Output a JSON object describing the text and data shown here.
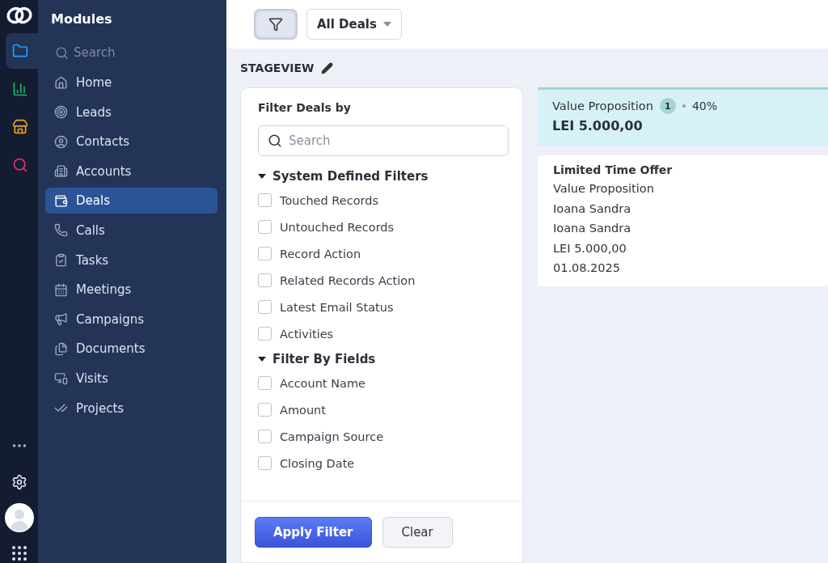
{
  "rail": {
    "items": [
      {
        "selected": true
      },
      {
        "selected": false
      },
      {
        "selected": false
      },
      {
        "selected": false
      }
    ]
  },
  "sidebar": {
    "title": "Modules",
    "search": {
      "placeholder": "Search"
    },
    "items": [
      {
        "label": "Home",
        "selected": false
      },
      {
        "label": "Leads",
        "selected": false
      },
      {
        "label": "Contacts",
        "selected": false
      },
      {
        "label": "Accounts",
        "selected": false
      },
      {
        "label": "Deals",
        "selected": true
      },
      {
        "label": "Calls",
        "selected": false
      },
      {
        "label": "Tasks",
        "selected": false
      },
      {
        "label": "Meetings",
        "selected": false
      },
      {
        "label": "Campaigns",
        "selected": false
      },
      {
        "label": "Documents",
        "selected": false
      },
      {
        "label": "Visits",
        "selected": false
      },
      {
        "label": "Projects",
        "selected": false
      }
    ]
  },
  "toolbar": {
    "filter_active": true,
    "view": "All Deals"
  },
  "view_title": "STAGEVIEW",
  "filter_panel": {
    "title": "Filter Deals by",
    "search": {
      "placeholder": "Search"
    },
    "groups": [
      {
        "label": "System Defined Filters",
        "expanded": true,
        "items": [
          {
            "label": "Touched Records",
            "checked": false
          },
          {
            "label": "Untouched Records",
            "checked": false
          },
          {
            "label": "Record Action",
            "checked": false
          },
          {
            "label": "Related Records Action",
            "checked": false
          },
          {
            "label": "Latest Email Status",
            "checked": false
          },
          {
            "label": "Activities",
            "checked": false
          }
        ]
      },
      {
        "label": "Filter By Fields",
        "expanded": true,
        "items": [
          {
            "label": "Account Name",
            "checked": false
          },
          {
            "label": "Amount",
            "checked": false
          },
          {
            "label": "Campaign Source",
            "checked": false
          },
          {
            "label": "Closing Date",
            "checked": false
          }
        ]
      }
    ],
    "buttons": [
      {
        "label": "Apply Filter",
        "kind": "primary"
      },
      {
        "label": "Clear",
        "kind": "secondary"
      }
    ]
  },
  "stage": {
    "name": "Value Proposition",
    "count": "1",
    "probability": "40%",
    "total": "LEI 5.000,00",
    "cards": [
      {
        "title": "Limited Time Offer",
        "lines": [
          "Value Proposition",
          "Ioana Sandra",
          "Ioana Sandra",
          "LEI 5.000,00",
          "01.08.2025"
        ]
      }
    ]
  }
}
